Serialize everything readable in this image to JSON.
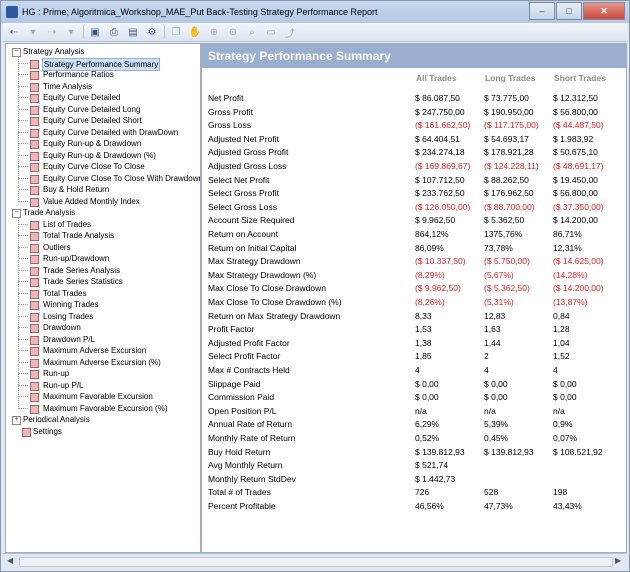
{
  "window": {
    "title": "HG : Prime; Algoritmica_Workshop_MAE_Put Back-Testing Strategy Performance Report",
    "min": "–",
    "max": "□",
    "close": "✕"
  },
  "tree": {
    "groups": [
      {
        "label": "Strategy Analysis",
        "items": [
          "Strategy Performance Summary",
          "Performance Ratios",
          "Time Analysis",
          "Equity Curve Detailed",
          "Equity Curve Detailed Long",
          "Equity Curve Detailed Short",
          "Equity Curve Detailed with DrawDown",
          "Equity Run-up & Drawdown",
          "Equity Run-up & Drawdown (%)",
          "Equity Curve Close To Close",
          "Equity Curve Close To Close With Drawdown",
          "Buy & Hold Return",
          "Value Added Monthly Index"
        ]
      },
      {
        "label": "Trade Analysis",
        "items": [
          "List of Trades",
          "Total Trade Analysis",
          "Outliers",
          "Run-up/Drawdown",
          "Trade Series Analysis",
          "Trade Series Statistics",
          "Total Trades",
          "Winning Trades",
          "Losing Trades",
          "Drawdown",
          "Drawdown P/L",
          "Maximum Adverse Excursion",
          "Maximum Adverse Excursion (%)",
          "Run-up",
          "Run-up P/L",
          "Maximum Favorable Excursion",
          "Maximum Favorable Excursion (%)"
        ]
      },
      {
        "label": "Periodical Analysis",
        "items": []
      }
    ],
    "settings": "Settings"
  },
  "report": {
    "title": "Strategy Performance Summary",
    "columns": [
      "All Trades",
      "Long Trades",
      "Short Trades"
    ],
    "rows": [
      {
        "label": "Net Profit",
        "v": [
          "$ 86.087,50",
          "$ 73.775,00",
          "$ 12.312,50"
        ],
        "neg": false
      },
      {
        "label": "Gross Profit",
        "v": [
          "$ 247.750,00",
          "$ 190.950,00",
          "$ 56.800,00"
        ],
        "neg": false
      },
      {
        "label": "Gross Loss",
        "v": [
          "($ 161.662,50)",
          "($ 117.175,00)",
          "($ 44.487,50)"
        ],
        "neg": true
      },
      {
        "label": "Adjusted Net Profit",
        "v": [
          "$ 64.404,51",
          "$ 54.693,17",
          "$ 1.983,92"
        ],
        "neg": false
      },
      {
        "label": "Adjusted Gross Profit",
        "v": [
          "$ 234.274,18",
          "$ 178.921,28",
          "$ 50.675,10"
        ],
        "neg": false
      },
      {
        "label": "Adjusted Gross Loss",
        "v": [
          "($ 169.869,67)",
          "($ 124.228,11)",
          "($ 48.691,17)"
        ],
        "neg": true
      },
      {
        "label": "Select Net Profit",
        "v": [
          "$ 107.712,50",
          "$ 88.262,50",
          "$ 19.450,00"
        ],
        "neg": false
      },
      {
        "label": "Select Gross Profit",
        "v": [
          "$ 233.762,50",
          "$ 176.962,50",
          "$ 56.800,00"
        ],
        "neg": false
      },
      {
        "label": "Select Gross Loss",
        "v": [
          "($ 126.050,00)",
          "($ 88.700,00)",
          "($ 37.350,00)"
        ],
        "neg": true
      },
      {
        "label": "Account Size Required",
        "v": [
          "$ 9.962,50",
          "$ 5.362,50",
          "$ 14.200,00"
        ],
        "neg": false
      },
      {
        "label": "Return on Account",
        "v": [
          "864,12%",
          "1375,76%",
          "86,71%"
        ],
        "neg": false
      },
      {
        "label": "Return on Initial Capital",
        "v": [
          "86,09%",
          "73,78%",
          "12,31%"
        ],
        "neg": false
      },
      {
        "label": "Max Strategy Drawdown",
        "v": [
          "($ 10.337,50)",
          "($ 5.750,00)",
          "($ 14.625,00)"
        ],
        "neg": true
      },
      {
        "label": "Max Strategy Drawdown (%)",
        "v": [
          "(8,29%)",
          "(5,67%)",
          "(14,28%)"
        ],
        "neg": true
      },
      {
        "label": "Max Close To Close Drawdown",
        "v": [
          "($ 9.962,50)",
          "($ 5.362,50)",
          "($ 14.200,00)"
        ],
        "neg": true
      },
      {
        "label": "Max Close To Close Drawdown (%)",
        "v": [
          "(8,26%)",
          "(5,31%)",
          "(13,87%)"
        ],
        "neg": true
      },
      {
        "label": "Return on Max Strategy Drawdown",
        "v": [
          "8,33",
          "12,83",
          "0,84"
        ],
        "neg": false
      },
      {
        "label": "Profit Factor",
        "v": [
          "1,53",
          "1,63",
          "1,28"
        ],
        "neg": false
      },
      {
        "label": "Adjusted Profit Factor",
        "v": [
          "1,38",
          "1,44",
          "1,04"
        ],
        "neg": false
      },
      {
        "label": "Select Profit Factor",
        "v": [
          "1,85",
          "2",
          "1,52"
        ],
        "neg": false
      },
      {
        "label": "Max # Contracts Held",
        "v": [
          "4",
          "4",
          "4"
        ],
        "neg": false
      },
      {
        "label": "Slippage Paid",
        "v": [
          "$ 0,00",
          "$ 0,00",
          "$ 0,00"
        ],
        "neg": false
      },
      {
        "label": "Commission Paid",
        "v": [
          "$ 0,00",
          "$ 0,00",
          "$ 0,00"
        ],
        "neg": false
      },
      {
        "label": "Open Position P/L",
        "v": [
          "n/a",
          "n/a",
          "n/a"
        ],
        "neg": false
      },
      {
        "label": "Annual Rate of Return",
        "v": [
          "6,29%",
          "5,39%",
          "0,9%"
        ],
        "neg": false
      },
      {
        "label": "Monthly Rate of Return",
        "v": [
          "0,52%",
          "0,45%",
          "0,07%"
        ],
        "neg": false
      },
      {
        "label": "Buy  Hold Return",
        "v": [
          "$ 139.812,93",
          "$ 139.812,93",
          "$ 108.521,92"
        ],
        "neg": false
      },
      {
        "label": "Avg Monthly Return",
        "v": [
          "$ 521,74",
          "",
          ""
        ],
        "neg": false
      },
      {
        "label": "Monthly Return StdDev",
        "v": [
          "$ 1.442,73",
          "",
          ""
        ],
        "neg": false
      },
      {
        "label": "Total # of Trades",
        "v": [
          "726",
          "528",
          "198"
        ],
        "neg": false
      },
      {
        "label": "Percent Profitable",
        "v": [
          "46,56%",
          "47,73%",
          "43,43%"
        ],
        "neg": false
      }
    ]
  },
  "toolbar_icons": [
    "back-icon",
    "forward-icon",
    "save-icon",
    "print-icon",
    "print-preview-icon",
    "settings-icon",
    "copy-icon",
    "hand-icon",
    "zoom-in-icon",
    "zoom-out-icon",
    "zoom-icon",
    "fit-icon",
    "export-icon"
  ]
}
